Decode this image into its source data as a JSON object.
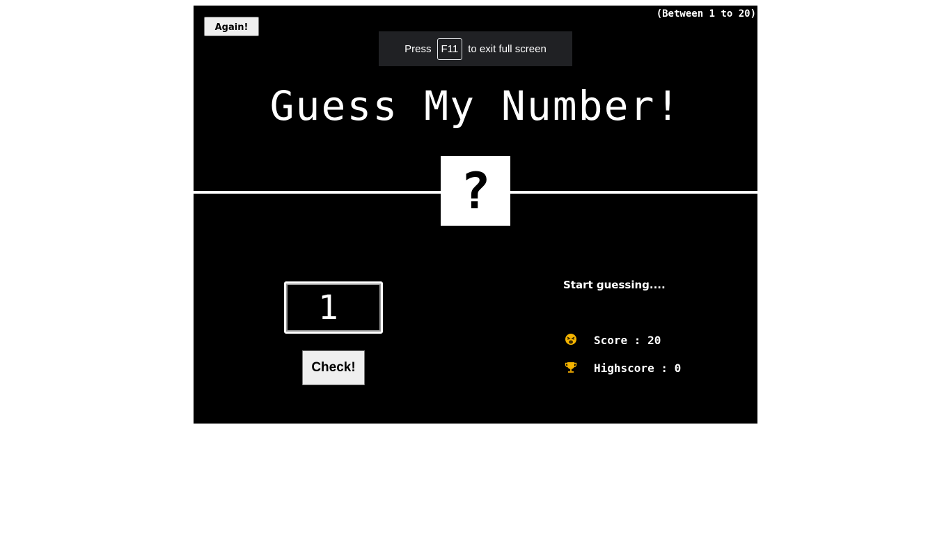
{
  "header": {
    "again_label": "Again!",
    "range_text": "(Between 1 to 20)"
  },
  "fullscreen_banner": {
    "prefix": "Press",
    "key": "F11",
    "suffix": "to exit full screen"
  },
  "title": "Guess My Number!",
  "secret_number": "?",
  "guess_input": {
    "value": "1"
  },
  "check_label": "Check!",
  "message": "Start guessing....",
  "stats": {
    "score_text": "Score : 20",
    "score_icon": "tired-face-icon",
    "highscore_text": "Highscore : 0",
    "highscore_icon": "trophy-icon"
  },
  "colors": {
    "background": "#000000",
    "foreground": "#ffffff",
    "trophy": "#f5b400"
  }
}
